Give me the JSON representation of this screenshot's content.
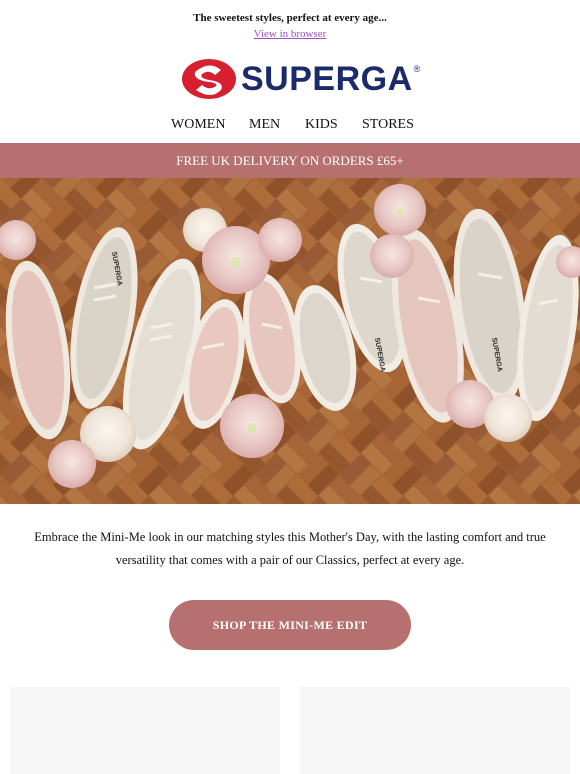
{
  "preheader": {
    "text": "The sweetest styles, perfect at every age...",
    "view_in_browser": "View in browser"
  },
  "brand": {
    "name": "SUPERGA",
    "registered_mark": "®",
    "colors": {
      "red": "#d6202f",
      "navy": "#1b2a6b"
    }
  },
  "nav": {
    "items": [
      "WOMEN",
      "MEN",
      "KIDS",
      "STORES"
    ]
  },
  "banner": {
    "text": "FREE UK DELIVERY ON ORDERS £65+",
    "color": "#b77070"
  },
  "hero": {
    "logo_on_shoe": "SUPERGA"
  },
  "body": {
    "copy": "Embrace the Mini-Me look in our matching styles this Mother's Day, with the lasting comfort and true versatility that comes with a pair of our Classics, perfect at every age."
  },
  "cta": {
    "label": "SHOP THE MINI-ME EDIT",
    "color": "#b77070"
  }
}
